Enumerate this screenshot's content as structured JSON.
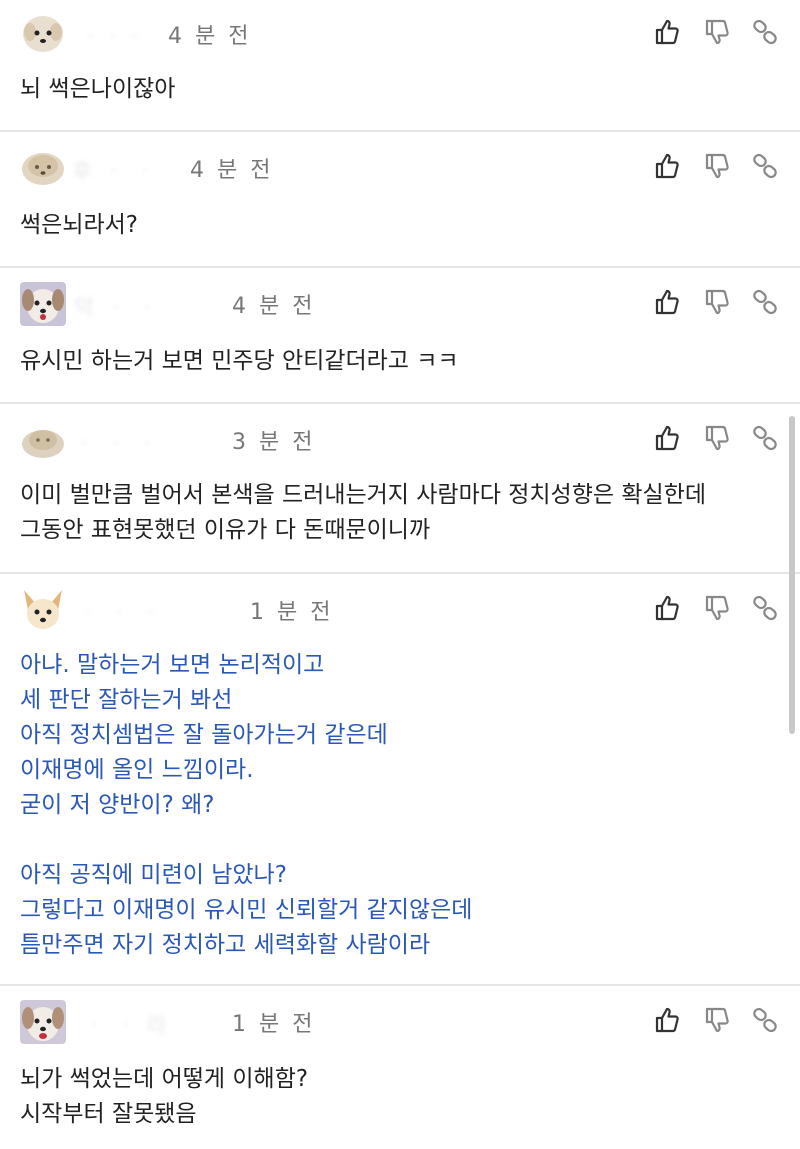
{
  "comments": [
    {
      "nickname": "ㆍㆍㆍ",
      "time": "4 분 전",
      "text": "뇌 썩은나이잖아",
      "avatar": "puppy-avatar"
    },
    {
      "nickname": "후 ㆍ ㆍ",
      "time": "4 분 전",
      "text": "썩은뇌라서?",
      "avatar": "puppy-avatar"
    },
    {
      "nickname": "악 ㆍ ㆍ",
      "time": "4 분 전",
      "text": "유시민 하는거 보면 민주당 안티같더라고 ㅋㅋ",
      "avatar": "dog-avatar"
    },
    {
      "nickname": "ㆍ ㆍ ㆍ",
      "time": "3 분 전",
      "text": "이미 벌만큼 벌어서 본색을 드러내는거지 사람마다 정치성향은 확실한데\n그동안 표현못했던 이유가 다 돈때문이니까",
      "avatar": "puppy-avatar"
    },
    {
      "nickname": "ㆍ ㆍ ㆍ",
      "time": "1 분 전",
      "text": "아냐. 말하는거 보면 논리적이고\n세 판단 잘하는거 봐선\n아직 정치셈법은 잘 돌아가는거 같은데\n이재명에 올인 느낌이라.\n굳이 저 양반이? 왜?\n\n아직 공직에 미련이 남았나?\n그렇다고 이재명이 유시민 신뢰할거 같지않은데\n틈만주면 자기 정치하고 세력화할 사람이라",
      "avatar": "chihuahua-avatar",
      "text_color": "#2a58b6"
    },
    {
      "nickname": "ㆍ ㆍ 라",
      "time": "1 분 전",
      "text": "뇌가 썩었는데 어떻게 이해함?\n시작부터 잘못됐음",
      "avatar": "dog-avatar"
    }
  ],
  "icons": {
    "like": "thumbs-up-icon",
    "dislike": "thumbs-down-icon",
    "share": "link-icon"
  },
  "colors": {
    "text": "#222222",
    "time": "#777777",
    "highlight_text": "#2a58b6",
    "divider": "#e6e6e6",
    "icon": "#333333",
    "icon_muted": "#888888"
  }
}
